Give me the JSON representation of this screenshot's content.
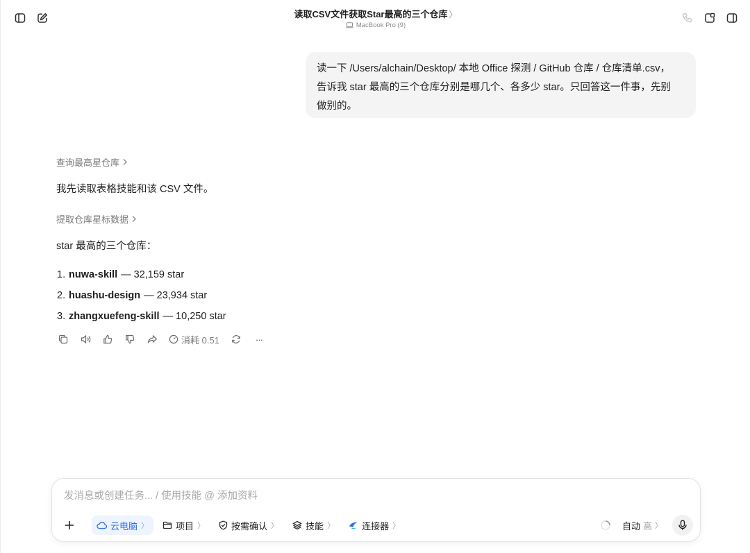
{
  "header": {
    "title": "读取CSV文件获取Star最高的三个仓库",
    "title_chevron": "〉",
    "device": "MacBook Pro (9)"
  },
  "chat": {
    "user_message_lines": [
      "读一下 /Users/alchain/Desktop/ 本地 Office 探测 / GitHub 仓库 / 仓库清单.csv，",
      "告诉我 star 最高的三个仓库分别是哪几个、各多少 star。只回答这一件事，先别",
      "做别的。"
    ],
    "step1_label": "查询最高星仓库",
    "text1": "我先读取表格技能和该 CSV 文件。",
    "step2_label": "提取仓库星标数据",
    "text2": "star 最高的三个仓库：",
    "results": [
      {
        "num": "1.",
        "name": "nuwa-skill",
        "rest": "— 32,159 star"
      },
      {
        "num": "2.",
        "name": "huashu-design",
        "rest": "— 23,934 star"
      },
      {
        "num": "3.",
        "name": "zhangxuefeng-skill",
        "rest": "— 10,250 star"
      }
    ],
    "cost_label": "消耗 0.51",
    "more_label": "···"
  },
  "composer": {
    "placeholder": "发消息或创建任务... / 使用技能 @ 添加资料",
    "chips": [
      {
        "label": "云电脑",
        "chev": "〉"
      },
      {
        "label": "项目",
        "chev": "〉"
      },
      {
        "label": "按需确认",
        "chev": "〉"
      },
      {
        "label": "技能",
        "chev": "〉"
      },
      {
        "label": "连接器",
        "chev": "〉"
      }
    ],
    "mode_label": "自动",
    "mode_level": "高",
    "mode_chev": "〉"
  },
  "colors": {
    "accent": "#2f6fe8",
    "bubble": "#f4f4f4",
    "muted": "#7a7a7a"
  }
}
